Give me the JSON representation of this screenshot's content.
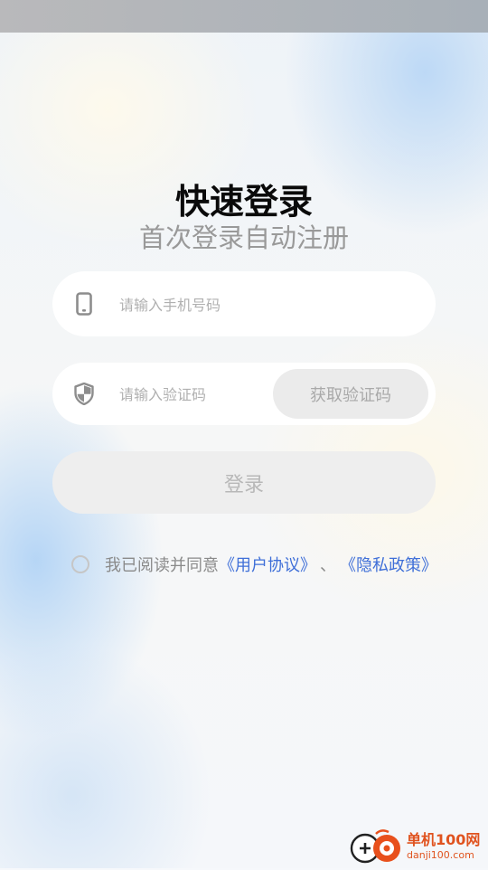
{
  "header": {
    "title": "快速登录",
    "subtitle": "首次登录自动注册"
  },
  "form": {
    "phone": {
      "placeholder": "请输入手机号码",
      "value": "",
      "icon": "phone-icon"
    },
    "code": {
      "placeholder": "请输入验证码",
      "value": "",
      "icon": "shield-icon",
      "get_code_label": "获取验证码"
    },
    "login_label": "登录"
  },
  "agreement": {
    "checked": false,
    "prefix": "我已阅读并同意",
    "user_agreement": "《用户协议》",
    "separator": "、",
    "privacy_policy": "《隐私政策》"
  },
  "watermark": {
    "name": "单机100网",
    "domain": "danji100.com"
  },
  "colors": {
    "link": "#3f6fd8",
    "button_disabled_bg": "#eeeeee",
    "button_disabled_text": "#b8b8b8",
    "placeholder": "#b0b0b0",
    "watermark": "#e0531f"
  }
}
